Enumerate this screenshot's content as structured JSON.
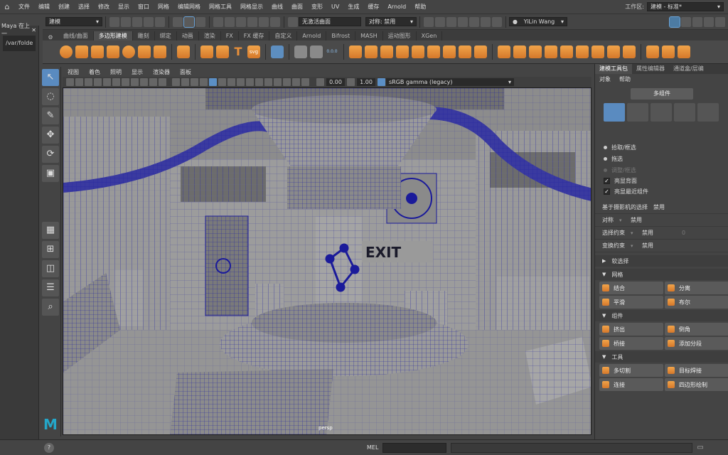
{
  "menubar": {
    "items": [
      "文件",
      "编辑",
      "创建",
      "选择",
      "修改",
      "显示",
      "窗口",
      "网格",
      "编辑网格",
      "网格工具",
      "网格显示",
      "曲线",
      "曲面",
      "变形",
      "UV",
      "生成",
      "缓存",
      "Arnold",
      "帮助"
    ],
    "workspace_label": "工作区:",
    "workspace_value": "建模 - 标准*"
  },
  "left_panel": {
    "title": "Maya 在上一",
    "path": "/var/folde"
  },
  "status_line": {
    "mode": "建模",
    "live_surface": "无激活曲面",
    "symmetry": "对称: 禁用",
    "user": "YiLin Wang"
  },
  "shelf": {
    "tabs": [
      "曲线/曲面",
      "多边形建模",
      "雕刻",
      "绑定",
      "动画",
      "渲染",
      "FX",
      "FX 缓存",
      "自定义",
      "Arnold",
      "Bifrost",
      "MASH",
      "运动图形",
      "XGen"
    ],
    "active_tab": 1,
    "text_icon": "T",
    "svg_icon": "svg",
    "counter": "0.0.0"
  },
  "viewport": {
    "menu": [
      "视图",
      "着色",
      "照明",
      "显示",
      "渲染器",
      "面板"
    ],
    "exposure": "0.00",
    "gamma": "1.00",
    "color_space": "sRGB gamma (legacy)",
    "camera_label": "persp",
    "exit_sign": "EXIT"
  },
  "right_panel": {
    "tabs": [
      "建模工具包",
      "属性编辑器",
      "通道盒/层编"
    ],
    "menu": [
      "对象",
      "帮助"
    ],
    "multi_component": "多组件",
    "selection": {
      "options": [
        "拾取/框选",
        "拖选",
        "调整/框选"
      ],
      "backface": "亮显背面",
      "recent": "亮显最近组件"
    },
    "camera_select_label": "基于摄影机的选择",
    "camera_select_value": "禁用",
    "symmetry_label": "对称",
    "symmetry_value": "禁用",
    "select_constraint_label": "选择约束",
    "select_constraint_value": "禁用",
    "select_constraint_num": "0",
    "transform_constraint_label": "变换约束",
    "transform_constraint_value": "禁用",
    "soft_select": "软选择",
    "mesh_header": "网格",
    "mesh_tools": [
      "结合",
      "分离",
      "平滑",
      "布尔"
    ],
    "component_header": "组件",
    "component_tools": [
      "挤出",
      "倒角",
      "桥接",
      "添加分段"
    ],
    "tools_header": "工具",
    "tools": [
      "多切割",
      "目标焊接",
      "连接",
      "四边形绘制"
    ]
  },
  "bottom": {
    "help": "?",
    "mel_label": "MEL"
  },
  "colors": {
    "accent": "#5a8bc0",
    "icon_orange": "#e8903a",
    "wire_blue": "#1a1a9a"
  }
}
